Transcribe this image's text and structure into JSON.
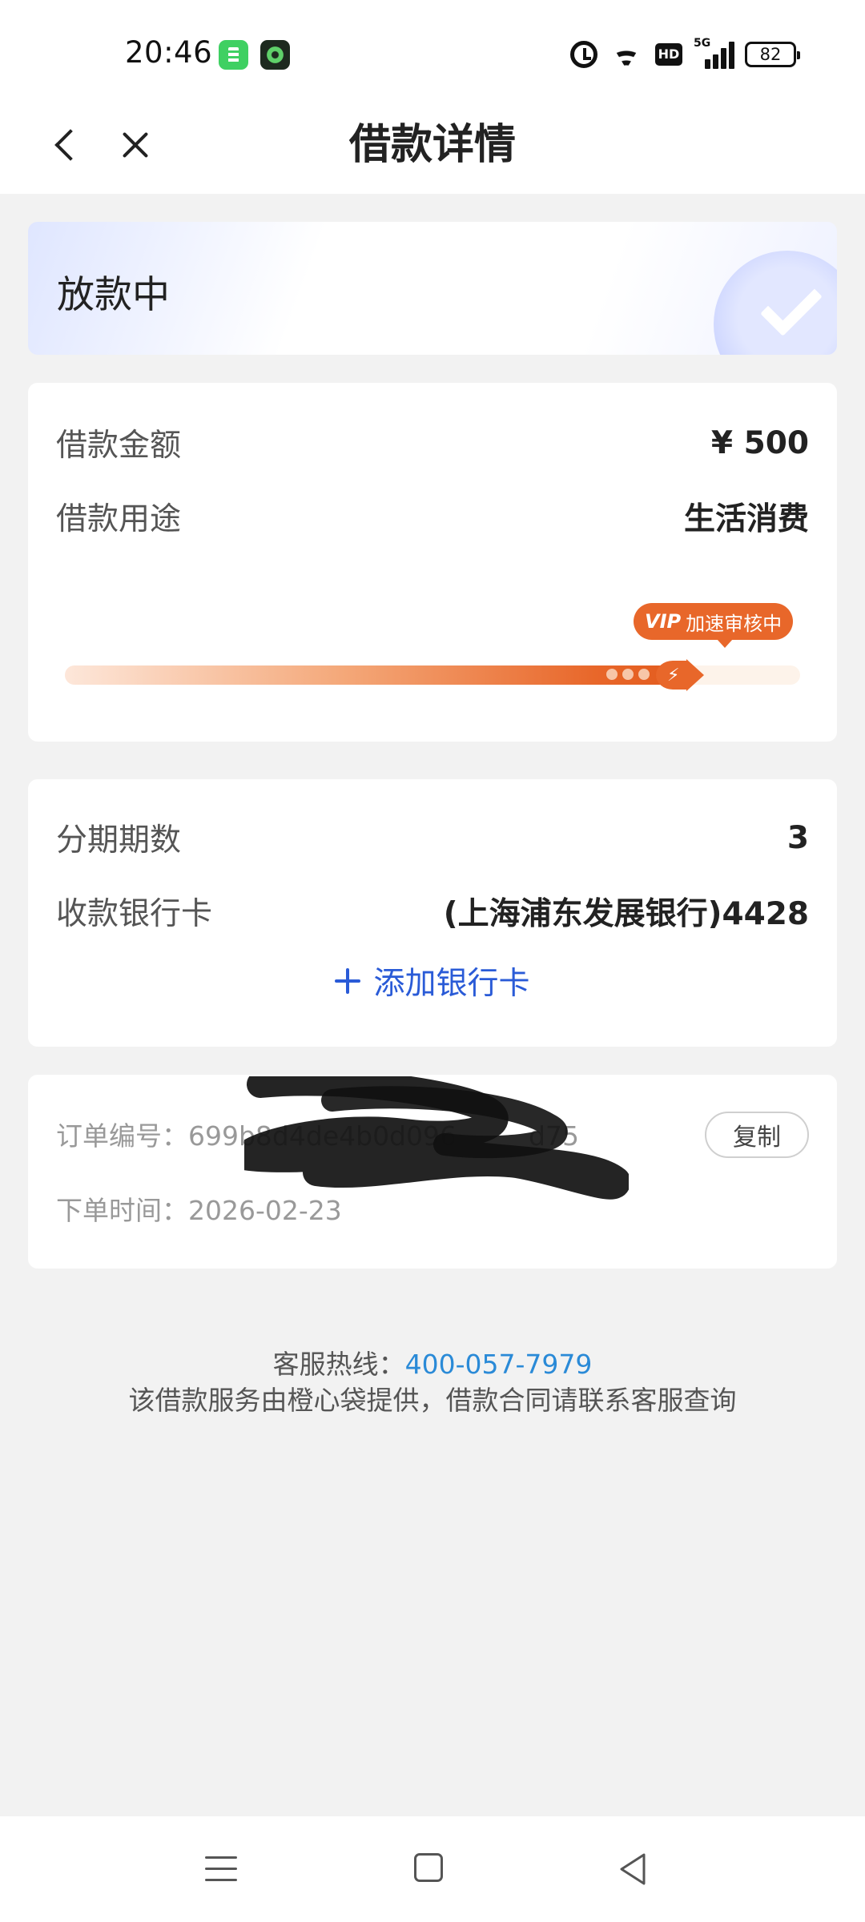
{
  "status_bar": {
    "time": "20:46",
    "hd_label": "HD",
    "network_label": "5G",
    "battery_level": "82",
    "icons": [
      "green-app-icon",
      "dark-app-icon",
      "alarm-icon",
      "wifi-icon",
      "hd-icon",
      "signal-icon",
      "battery-icon"
    ]
  },
  "nav": {
    "title": "借款详情",
    "back_icon": "chevron-left-icon",
    "close_icon": "close-icon"
  },
  "status_card": {
    "status": "放款中",
    "icon": "check-icon"
  },
  "loan_info": {
    "amount_label": "借款金额",
    "amount_value": "¥ 500",
    "purpose_label": "借款用途",
    "purpose_value": "生活消费",
    "vip_logo": "VIP",
    "vip_badge_text": "加速审核中",
    "progress_percent": 85
  },
  "installment": {
    "periods_label": "分期期数",
    "periods_value": "3",
    "bank_label": "收款银行卡",
    "bank_value": "(上海浦东发展银行)4428",
    "add_card_label": "添加银行卡"
  },
  "order": {
    "number_label": "订单编号：",
    "number_value": "699b8d4de4b0d096",
    "number_tail": "d75",
    "time_label": "下单时间：",
    "time_value": "2026-02-23",
    "copy_label": "复制"
  },
  "footer": {
    "hotline_label": "客服热线：",
    "hotline_number": "400-057-7979",
    "note": "该借款服务由橙心袋提供，借款合同请联系客服查询"
  },
  "colors": {
    "accent_blue": "#2a5bd7",
    "link_blue": "#2a8ad7",
    "vip_orange": "#e8672a",
    "background": "#f2f2f2"
  }
}
